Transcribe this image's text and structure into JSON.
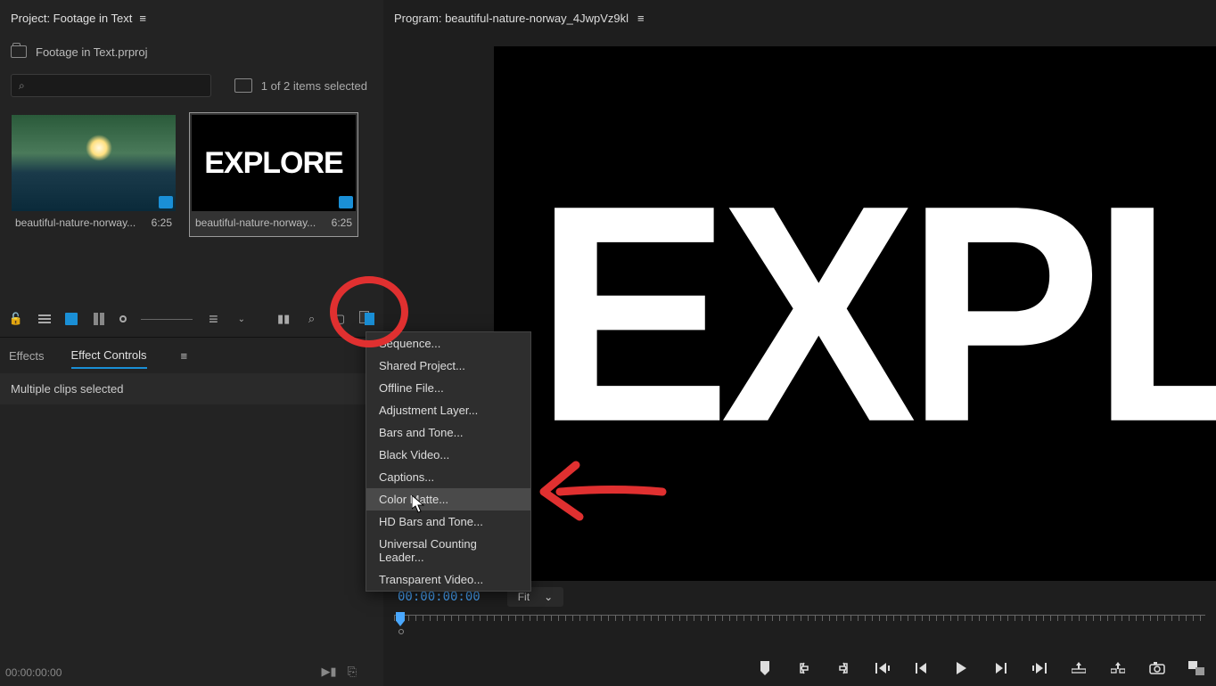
{
  "project_panel": {
    "title": "Project: Footage in Text",
    "file_name": "Footage in Text.prproj",
    "selection_status": "1 of 2 items selected",
    "clips": [
      {
        "name": "beautiful-nature-norway...",
        "duration": "6:25",
        "thumb_text": ""
      },
      {
        "name": "beautiful-nature-norway...",
        "duration": "6:25",
        "thumb_text": "EXPLORE"
      }
    ]
  },
  "effects_panel": {
    "tabs": [
      "Effects",
      "Effect Controls"
    ],
    "status": "Multiple clips selected",
    "timecode": "00:00:00:00"
  },
  "program_panel": {
    "title": "Program: beautiful-nature-norway_4JwpVz9kl",
    "monitor_text": "EXPLORE",
    "timecode": "00:00:00:00",
    "fit_label": "Fit"
  },
  "context_menu": {
    "items": [
      "Sequence...",
      "Shared Project...",
      "Offline File...",
      "Adjustment Layer...",
      "Bars and Tone...",
      "Black Video...",
      "Captions...",
      "Color Matte...",
      "HD Bars and Tone...",
      "Universal Counting Leader...",
      "Transparent Video..."
    ],
    "hovered_index": 7
  }
}
